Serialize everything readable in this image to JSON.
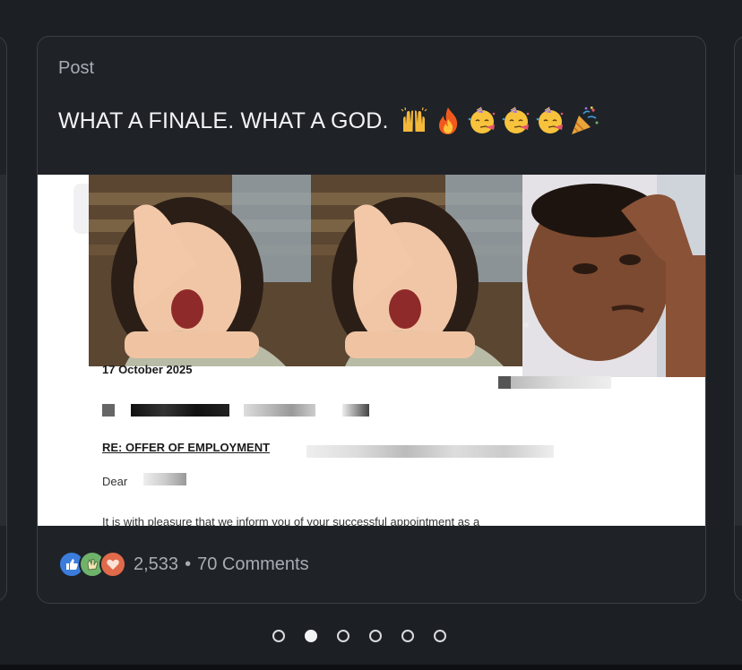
{
  "card": {
    "label": "Post",
    "text": "WHAT A FINALE. WHAT A GOD.",
    "emojis": [
      "raising-hands-emoji",
      "fire-emoji",
      "partying-face-emoji",
      "partying-face-emoji",
      "partying-face-emoji",
      "party-popper-emoji"
    ]
  },
  "media": {
    "date": "17 October 2025",
    "heading": "RE: OFFER OF EMPLOYMENT",
    "salutation": "Dear",
    "body_line": "It is with pleasure that we inform you of your successful appointment as a"
  },
  "footer": {
    "reaction_icons": [
      "like-reaction-icon",
      "clap-reaction-icon",
      "love-reaction-icon"
    ],
    "reaction_count": "2,533",
    "separator": "•",
    "comments": "70 Comments"
  },
  "pagination": {
    "total": 6,
    "active_index": 1
  },
  "colors": {
    "background": "#1c1f24",
    "card": "#1f2328",
    "like": "#3b7ddd",
    "clap": "#6fb36a",
    "love": "#e06a4a"
  }
}
